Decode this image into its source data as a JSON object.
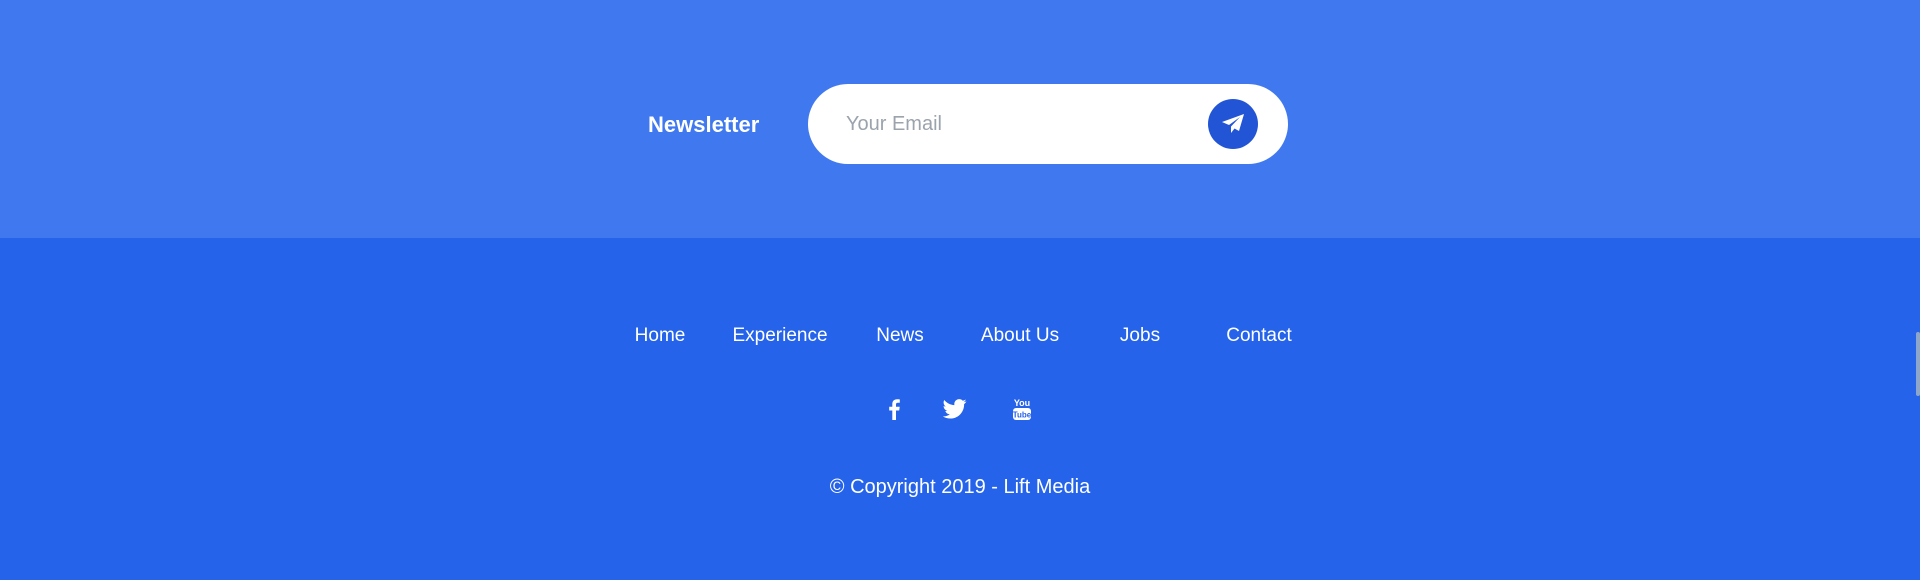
{
  "newsletter": {
    "label": "Newsletter",
    "email_placeholder": "Your Email",
    "send_icon": "paper-plane-icon"
  },
  "footer": {
    "nav": [
      "Home",
      "Experience",
      "News",
      "About Us",
      "Jobs",
      "Contact"
    ],
    "social_icons": [
      "facebook-icon",
      "twitter-icon",
      "youtube-icon"
    ],
    "copyright": "© Copyright 2019 - Lift Media"
  },
  "colors": {
    "newsletter_bg": "#4079ef",
    "footer_bg": "#2563eb",
    "send_button_bg": "#2255d6",
    "text": "#ffffff"
  }
}
